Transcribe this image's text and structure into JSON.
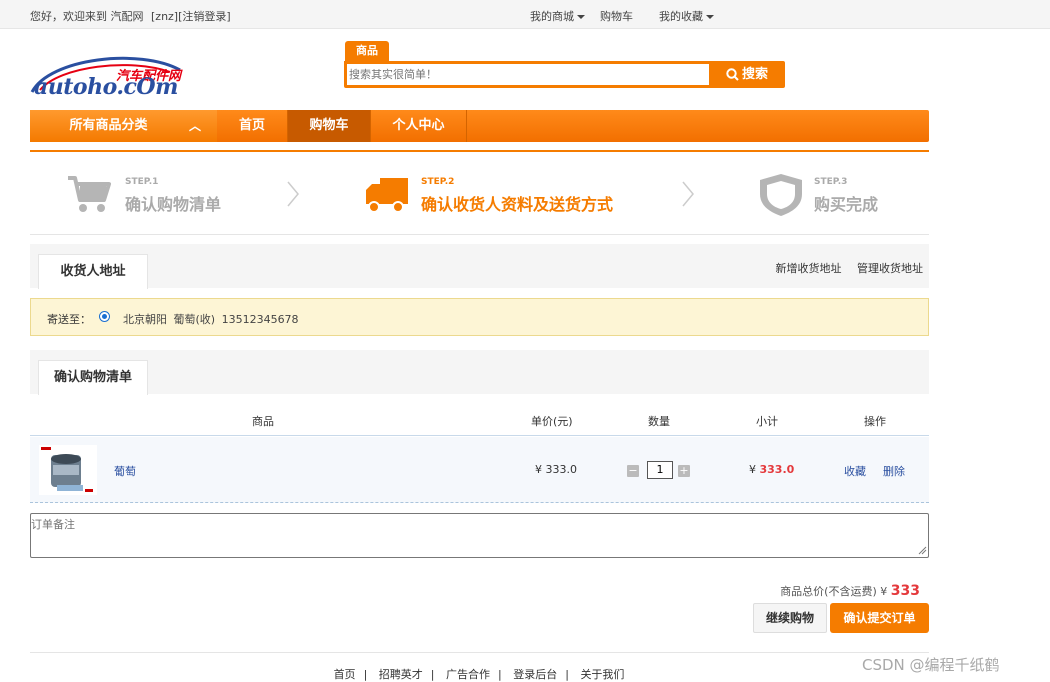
{
  "topbar": {
    "welcome": "您好，欢迎来到 汽配网",
    "user": "[znz][",
    "logout": "注销登录",
    "close_bracket": "]",
    "my_mall": "我的商城",
    "cart": "购物车",
    "favorites": "我的收藏"
  },
  "logo": {
    "brand": "autoho.cOm",
    "cn": "汽车配件网"
  },
  "search": {
    "tab": "商品",
    "placeholder": "搜索其实很简单！",
    "button": "搜索"
  },
  "nav": {
    "categories": "所有商品分类",
    "chevron": "︿",
    "items": [
      "首页",
      "购物车",
      "个人中心"
    ]
  },
  "steps": [
    {
      "num": "STEP.1",
      "label": "确认购物清单",
      "icon": "cart-icon",
      "state": "done"
    },
    {
      "num": "STEP.2",
      "label": "确认收货人资料及送货方式",
      "icon": "truck-icon",
      "state": "active"
    },
    {
      "num": "STEP.3",
      "label": "购买完成",
      "icon": "shield-icon",
      "state": "pending"
    }
  ],
  "address": {
    "tab": "收货人地址",
    "add": "新增收货地址",
    "manage": "管理收货地址",
    "send_to": "寄送至：",
    "selected": "北京朝阳  葡萄(收)  13512345678"
  },
  "cart_list": {
    "tab": "确认购物清单",
    "headers": {
      "product": "商品",
      "unit_price": "单价(元)",
      "quantity": "数量",
      "subtotal": "小计",
      "actions": "操作"
    },
    "items": [
      {
        "name": "葡萄",
        "unit_price": "¥ 333.0",
        "quantity": "1",
        "subtotal_symbol": "¥ ",
        "subtotal": "333.0",
        "favorite": "收藏",
        "delete": "删除"
      }
    ]
  },
  "order": {
    "remark_placeholder": "订单备注",
    "total_label": "商品总价(不含运费) ¥ ",
    "total_value": "333",
    "continue": "继续购物",
    "confirm": "确认提交订单"
  },
  "footer": {
    "links": [
      "首页",
      "招聘英才",
      "广告合作",
      "登录后台",
      "关于我们"
    ],
    "sep": "|"
  },
  "watermark": "CSDN @编程千纸鹤",
  "colors": {
    "accent": "#f57c00",
    "link": "#2a4fa0",
    "price": "#e4393c",
    "address_bg": "#fdf5d5"
  }
}
